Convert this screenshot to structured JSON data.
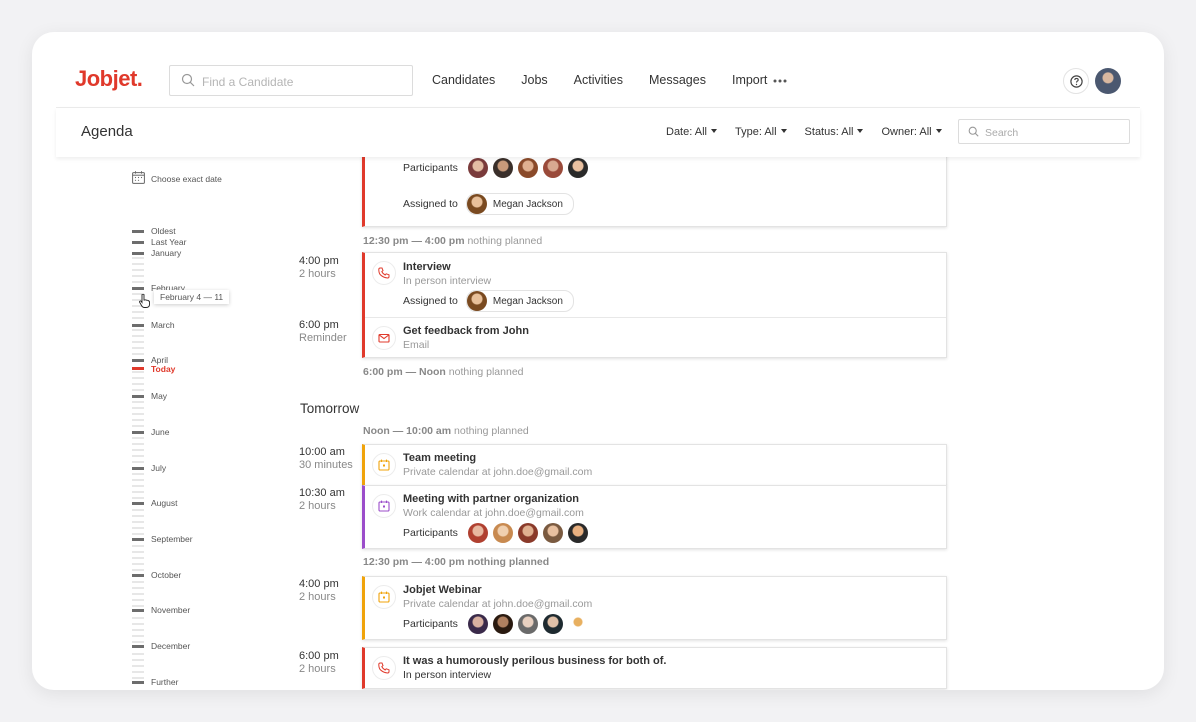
{
  "app": {
    "logo": "Jobjet."
  },
  "header": {
    "find_placeholder": "Find a Candidate",
    "nav": [
      "Candidates",
      "Jobs",
      "Activities",
      "Messages",
      "Import"
    ]
  },
  "subheader": {
    "title": "Agenda",
    "filters": [
      "Date: All",
      "Type: All",
      "Status: All",
      "Owner: All"
    ],
    "search_placeholder": "Search"
  },
  "timeline": {
    "choose_exact_date": "Choose exact date",
    "labels": [
      "Oldest",
      "Last Year",
      "January",
      "February",
      "March",
      "April",
      "Today",
      "May",
      "June",
      "July",
      "August",
      "September",
      "October",
      "November",
      "December",
      "Further"
    ],
    "tooltip": "February 4 — 11"
  },
  "agenda": {
    "partial_card": {
      "participants_label": "Participants",
      "assigned_label": "Assigned to",
      "assignee": "Megan Jackson"
    },
    "gap1": {
      "range": "12:30 pm — 4:00 pm",
      "text": "nothing planned"
    },
    "slot_interview": {
      "time": "4:00 pm",
      "duration": "2 hours",
      "title": "Interview",
      "subtitle": "In person interview",
      "assigned_label": "Assigned to",
      "assignee": "Megan Jackson"
    },
    "slot_feedback": {
      "time": "6:00 pm",
      "duration": "Reminder",
      "title": "Get feedback from John",
      "subtitle": "Email"
    },
    "gap2": {
      "range": "6:00 pm — Noon",
      "text": "nothing planned"
    },
    "tomorrow": {
      "title": "Tomorrow",
      "gap_morning": {
        "range": "Noon — 10:00 am",
        "text": "nothing planned"
      },
      "team_meeting": {
        "time": "10:00 am",
        "duration": "30 minutes",
        "title": "Team meeting",
        "subtitle": "Private calendar at john.doe@gmail.com"
      },
      "partner_meeting": {
        "time": "10:30 am",
        "duration": "2 hours",
        "title": "Meeting with partner organization",
        "subtitle": "Work calendar at john.doe@gmail.com",
        "participants_label": "Participants"
      },
      "gap_afternoon": {
        "range": "12:30 pm — 4:00 pm",
        "text": "nothing planned"
      },
      "webinar": {
        "time": "4:00 pm",
        "duration": "2 hours",
        "title": "Jobjet Webinar",
        "subtitle": "Private calendar at john.doe@gmail.com",
        "participants_label": "Participants"
      },
      "business": {
        "time": "6:00 pm",
        "duration": "2 hours",
        "title": "It was a humorously perilous business for both of.",
        "subtitle": "In person interview"
      }
    }
  },
  "colors": {
    "brand": "#e0392b",
    "reminder_red": "#e0392b",
    "calendar_orange": "#f0a30a",
    "calendar_purple": "#9b4dca"
  },
  "icons": {
    "search": "search-icon",
    "more": "more-horizontal-icon",
    "help": "help-circle-icon",
    "calendar": "calendar-icon",
    "phone": "phone-icon",
    "mail": "mail-icon",
    "cursor": "hand-cursor-icon"
  }
}
